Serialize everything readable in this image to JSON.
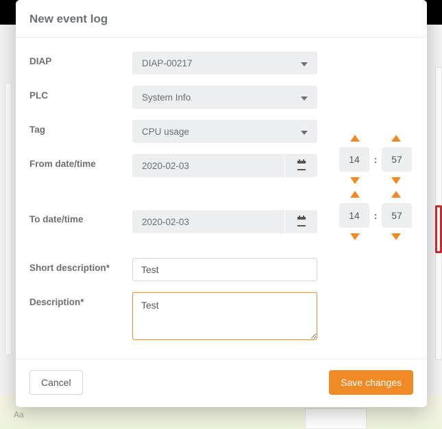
{
  "modal": {
    "title": "New event log",
    "labels": {
      "diap": "DIAP",
      "plc": "PLC",
      "tag": "Tag",
      "from": "From date/time",
      "to": "To date/time",
      "short_desc": "Short description*",
      "desc": "Description*"
    },
    "values": {
      "diap": "DIAP-00217",
      "plc": "System Info",
      "tag": "CPU usage",
      "from_date": "2020-02-03",
      "from_hour": "14",
      "from_min": "57",
      "to_date": "2020-02-03",
      "to_hour": "14",
      "to_min": "57",
      "short_desc": "Test",
      "desc": "Test"
    },
    "buttons": {
      "cancel": "Cancel",
      "save": "Save changes"
    }
  },
  "background": {
    "map_hint": "Aa"
  }
}
